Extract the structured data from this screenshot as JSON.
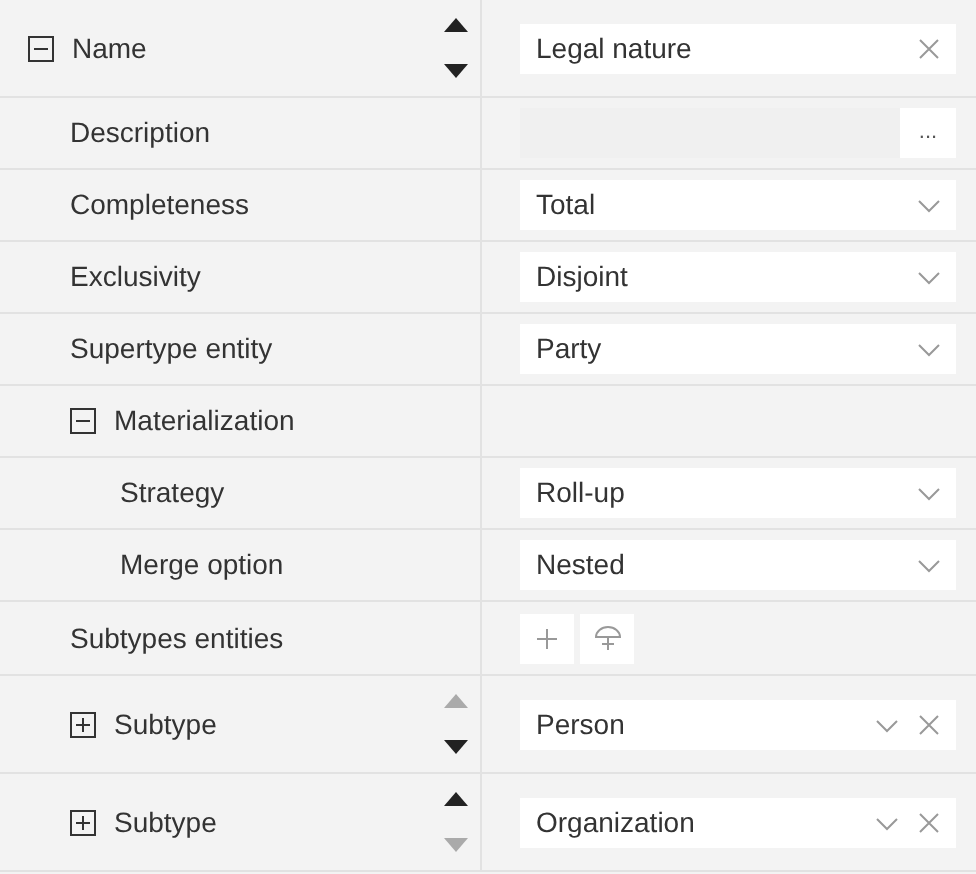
{
  "properties": [
    {
      "label": "Name",
      "expanded": true,
      "can_move_up": true,
      "can_move_down": true,
      "field": {
        "kind": "text",
        "value": "Legal nature",
        "clearable": true
      },
      "children": [
        {
          "label": "Description",
          "field": {
            "kind": "ellipsis",
            "button": "..."
          }
        },
        {
          "label": "Completeness",
          "field": {
            "kind": "dropdown",
            "value": "Total"
          }
        },
        {
          "label": "Exclusivity",
          "field": {
            "kind": "dropdown",
            "value": "Disjoint"
          }
        },
        {
          "label": "Supertype entity",
          "field": {
            "kind": "dropdown",
            "value": "Party"
          }
        },
        {
          "label": "Materialization",
          "expanded": true,
          "children": [
            {
              "label": "Strategy",
              "field": {
                "kind": "dropdown",
                "value": "Roll-up"
              }
            },
            {
              "label": "Merge option",
              "field": {
                "kind": "dropdown",
                "value": "Nested"
              }
            }
          ]
        },
        {
          "label": "Subtypes entities",
          "field": {
            "kind": "actions"
          }
        },
        {
          "label": "Subtype",
          "expanded": false,
          "can_move_up": false,
          "can_move_down": true,
          "field": {
            "kind": "dropdown",
            "value": "Person",
            "clearable": true
          }
        },
        {
          "label": "Subtype",
          "expanded": false,
          "can_move_up": true,
          "can_move_down": false,
          "field": {
            "kind": "dropdown",
            "value": "Organization",
            "clearable": true
          }
        }
      ]
    }
  ]
}
